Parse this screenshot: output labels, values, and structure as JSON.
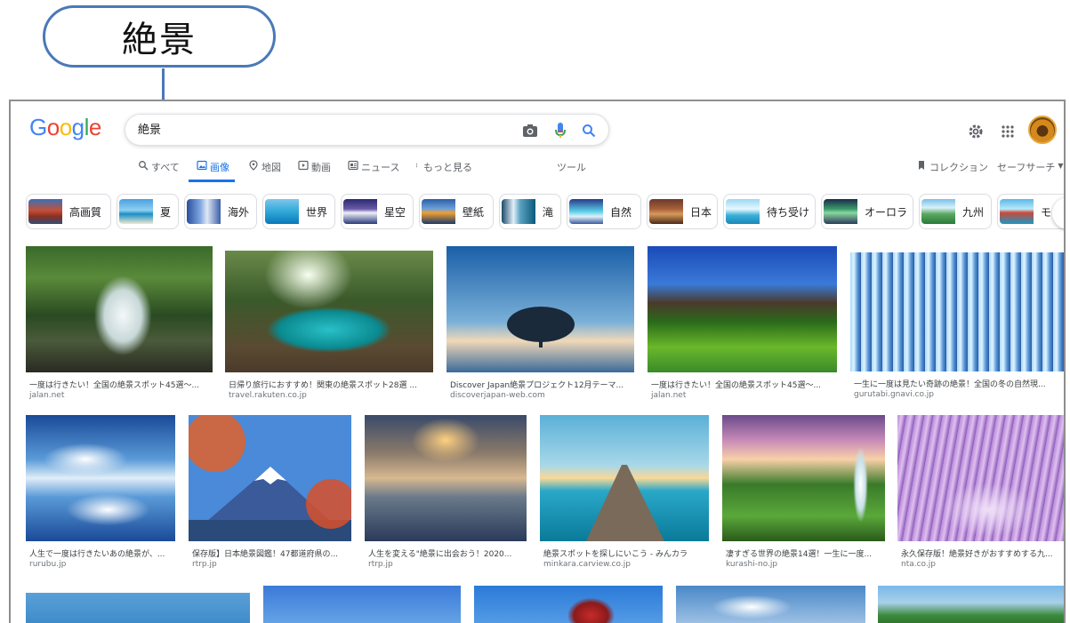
{
  "callout": {
    "text": "絶景"
  },
  "header": {
    "logo_letters": [
      {
        "char": "G",
        "color": "#4285f4"
      },
      {
        "char": "o",
        "color": "#ea4335"
      },
      {
        "char": "o",
        "color": "#fbbc05"
      },
      {
        "char": "g",
        "color": "#4285f4"
      },
      {
        "char": "l",
        "color": "#34a853"
      },
      {
        "char": "e",
        "color": "#ea4335"
      }
    ],
    "search_value": "絶景",
    "icons": {
      "camera": "camera-icon",
      "mic": "microphone-icon",
      "search": "search-icon",
      "settings": "gear-icon",
      "apps": "apps-grid-icon"
    }
  },
  "tabs": {
    "all": "すべて",
    "images": "画像",
    "maps": "地図",
    "videos": "動画",
    "news": "ニュース",
    "more": "もっと見る",
    "tools": "ツール",
    "collections": "コレクション",
    "safesearch": "セーフサーチ"
  },
  "chips": [
    {
      "label": "高画質"
    },
    {
      "label": "夏"
    },
    {
      "label": "海外"
    },
    {
      "label": "世界"
    },
    {
      "label": "星空"
    },
    {
      "label": "壁紙"
    },
    {
      "label": "滝"
    },
    {
      "label": "自然"
    },
    {
      "label": "日本"
    },
    {
      "label": "待ち受け"
    },
    {
      "label": "オーロラ"
    },
    {
      "label": "九州"
    },
    {
      "label": "モ"
    }
  ],
  "results": [
    {
      "title": "一度は行きたい！全国の絶景スポット45選～...",
      "source": "jalan.net"
    },
    {
      "title": "日帰り旅行におすすめ！関東の絶景スポット28選 ...",
      "source": "travel.rakuten.co.jp"
    },
    {
      "title": "Discover Japan絶景プロジェクト12月テーマ...",
      "source": "discoverjapan-web.com"
    },
    {
      "title": "一度は行きたい！全国の絶景スポット45選～...",
      "source": "jalan.net"
    },
    {
      "title": "一生に一度は見たい奇跡の絶景！全国の冬の自然現...",
      "source": "gurutabi.gnavi.co.jp"
    },
    {
      "title": "人生で一度は行きたいあの絶景が、...",
      "source": "rurubu.jp"
    },
    {
      "title": "保存版】日本絶景図鑑！47都道府県の...",
      "source": "rtrp.jp"
    },
    {
      "title": "人生を変える\"絶景に出会おう！2020...",
      "source": "rtrp.jp"
    },
    {
      "title": "絶景スポットを探しにいこう - みんカラ",
      "source": "minkara.carview.co.jp"
    },
    {
      "title": "凄すぎる世界の絶景14選！一生に一度...",
      "source": "kurashi-no.jp"
    },
    {
      "title": "永久保存版！絶景好きがおすすめする九...",
      "source": "nta.co.jp"
    }
  ]
}
